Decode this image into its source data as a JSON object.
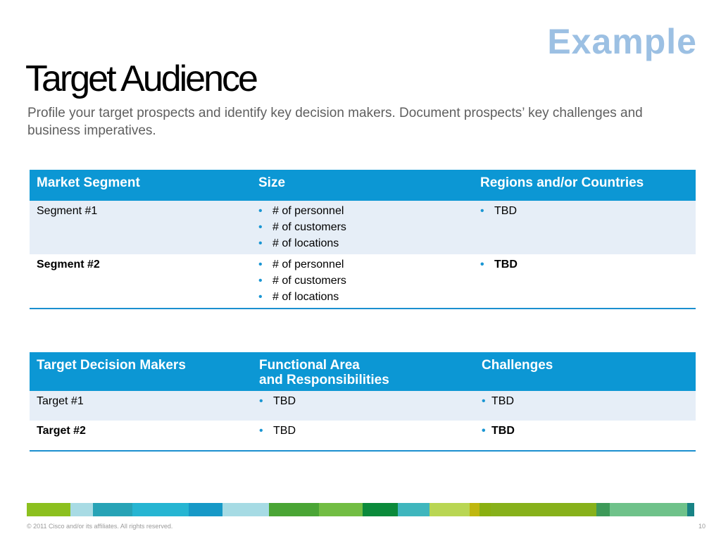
{
  "slide": {
    "example_label": "Example",
    "title": "Target Audience",
    "subtitle": "Profile your target prospects and identify key decision makers. Document prospects’ key challenges and business imperatives."
  },
  "table1": {
    "headers": [
      "Market Segment",
      "Size",
      "Regions and/or Countries"
    ],
    "rows": [
      {
        "segment": "Segment #1",
        "size": [
          "# of personnel",
          "# of customers",
          "# of  locations"
        ],
        "regions": [
          "TBD"
        ]
      },
      {
        "segment": "Segment #2",
        "size": [
          "# of personnel",
          "# of customers",
          "# of locations"
        ],
        "regions": [
          "TBD"
        ]
      }
    ]
  },
  "table2": {
    "headers": [
      "Target Decision Makers",
      "Functional Area",
      "and Responsibilities",
      "Challenges"
    ],
    "rows": [
      {
        "target": "Target #1",
        "area": [
          "TBD"
        ],
        "challenges": [
          "TBD"
        ]
      },
      {
        "target": "Target #2",
        "area": [
          "TBD"
        ],
        "challenges": [
          "TBD"
        ]
      }
    ]
  },
  "footer": {
    "copyright": "© 2011 Cisco and/or its affiliates. All rights reserved.",
    "page_number": "10",
    "bar_colors": [
      "#8cc01f",
      "#a8dbe4",
      "#27a3b6",
      "#26b5d2",
      "#1799c7",
      "#a6dbe4",
      "#4aa535",
      "#72bd43",
      "#0b8a3b",
      "#3fb6bd",
      "#b9d653",
      "#bfb70f",
      "#8ab010",
      "#87b11b",
      "#3e9a59",
      "#6fc28a",
      "#72c995",
      "#188385"
    ],
    "bar_weights": [
      62,
      32,
      55,
      80,
      48,
      66,
      70,
      62,
      50,
      45,
      56,
      14,
      16,
      150,
      18,
      110,
      0,
      10
    ]
  }
}
